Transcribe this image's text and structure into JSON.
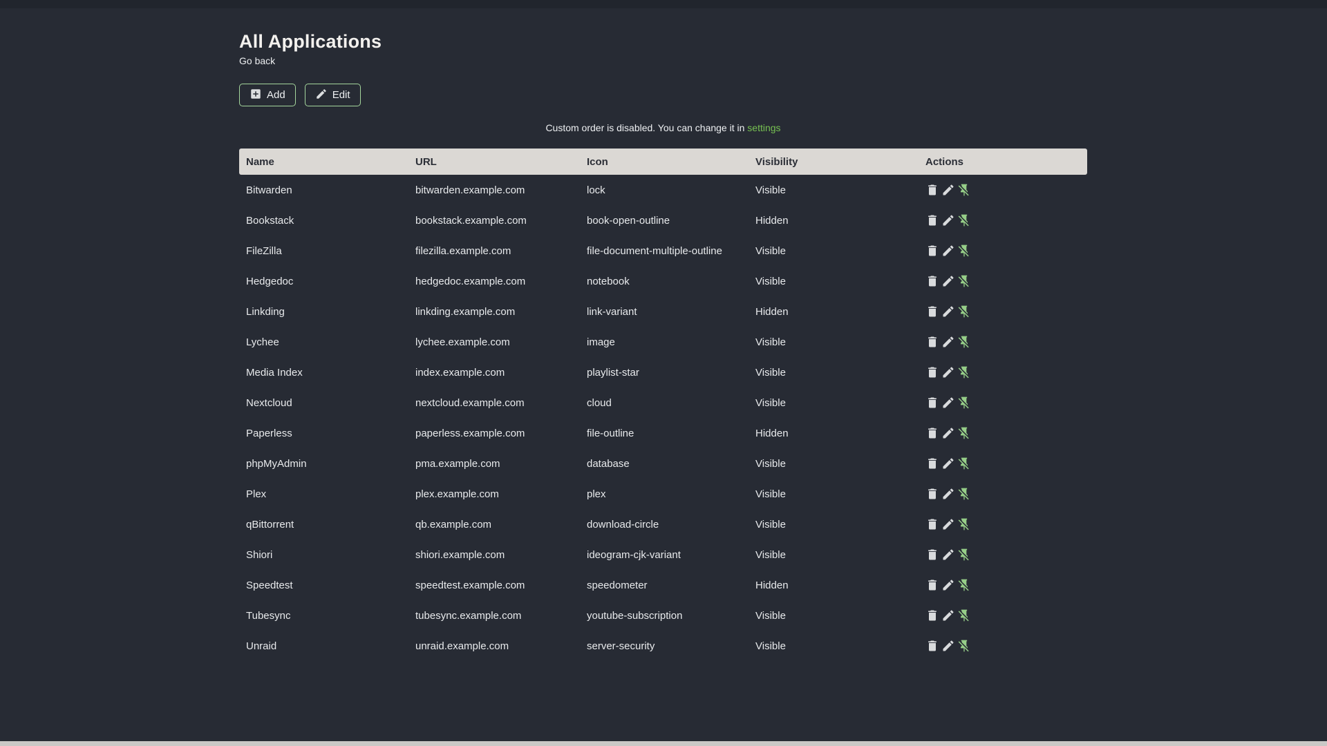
{
  "page": {
    "title": "All Applications",
    "back_label": "Go back"
  },
  "toolbar": {
    "add_label": "Add",
    "edit_label": "Edit"
  },
  "notice": {
    "text_before": "Custom order is disabled. You can change it in ",
    "link_label": "settings"
  },
  "table": {
    "columns": [
      "Name",
      "URL",
      "Icon",
      "Visibility",
      "Actions"
    ],
    "action_icons": [
      "delete",
      "edit",
      "pin-off"
    ],
    "rows": [
      {
        "name": "Bitwarden",
        "url": "bitwarden.example.com",
        "icon": "lock",
        "visibility": "Visible"
      },
      {
        "name": "Bookstack",
        "url": "bookstack.example.com",
        "icon": "book-open-outline",
        "visibility": "Hidden"
      },
      {
        "name": "FileZilla",
        "url": "filezilla.example.com",
        "icon": "file-document-multiple-outline",
        "visibility": "Visible"
      },
      {
        "name": "Hedgedoc",
        "url": "hedgedoc.example.com",
        "icon": "notebook",
        "visibility": "Visible"
      },
      {
        "name": "Linkding",
        "url": "linkding.example.com",
        "icon": "link-variant",
        "visibility": "Hidden"
      },
      {
        "name": "Lychee",
        "url": "lychee.example.com",
        "icon": "image",
        "visibility": "Visible"
      },
      {
        "name": "Media Index",
        "url": "index.example.com",
        "icon": "playlist-star",
        "visibility": "Visible"
      },
      {
        "name": "Nextcloud",
        "url": "nextcloud.example.com",
        "icon": "cloud",
        "visibility": "Visible"
      },
      {
        "name": "Paperless",
        "url": "paperless.example.com",
        "icon": "file-outline",
        "visibility": "Hidden"
      },
      {
        "name": "phpMyAdmin",
        "url": "pma.example.com",
        "icon": "database",
        "visibility": "Visible"
      },
      {
        "name": "Plex",
        "url": "plex.example.com",
        "icon": "plex",
        "visibility": "Visible"
      },
      {
        "name": "qBittorrent",
        "url": "qb.example.com",
        "icon": "download-circle",
        "visibility": "Visible"
      },
      {
        "name": "Shiori",
        "url": "shiori.example.com",
        "icon": "ideogram-cjk-variant",
        "visibility": "Visible"
      },
      {
        "name": "Speedtest",
        "url": "speedtest.example.com",
        "icon": "speedometer",
        "visibility": "Hidden"
      },
      {
        "name": "Tubesync",
        "url": "tubesync.example.com",
        "icon": "youtube-subscription",
        "visibility": "Visible"
      },
      {
        "name": "Unraid",
        "url": "unraid.example.com",
        "icon": "server-security",
        "visibility": "Visible"
      }
    ]
  },
  "colors": {
    "background": "#272b34",
    "table_header_bg": "#dbd8d4",
    "table_header_text": "#2b2e36",
    "body_text": "#e8eaec",
    "accent_green_link": "#77c152",
    "accent_green_icon": "#96ce88",
    "button_border": "#a5d79d",
    "scrollbar_track": "#cac8c6"
  }
}
